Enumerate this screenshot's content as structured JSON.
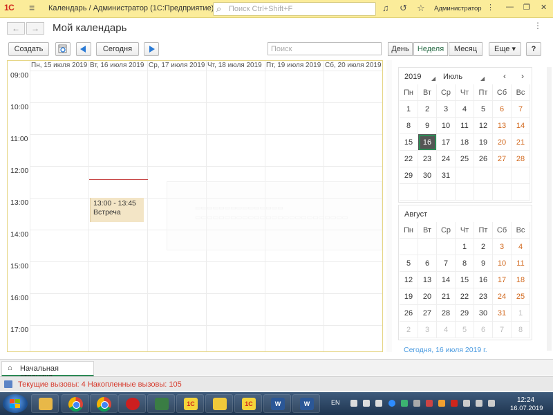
{
  "window": {
    "logo": "1С",
    "title": "Календарь / Администратор  (1С:Предприятие)",
    "search_placeholder": "Поиск Ctrl+Shift+F",
    "user": "Администратор"
  },
  "header": {
    "page_title": "Мой календарь",
    "back": "←",
    "forward": "→"
  },
  "toolbar": {
    "create_label": "Создать",
    "today_label": "Сегодня",
    "search_placeholder": "Поиск",
    "views": [
      "День",
      "Неделя",
      "Месяц"
    ],
    "active_view": "Неделя",
    "more_label": "Еще ▾",
    "help_label": "?"
  },
  "calendar": {
    "days": [
      "Пн, 15 июля 2019",
      "Вт, 16 июля 2019",
      "Ср, 17 июля 2019",
      "Чт, 18 июля 2019",
      "Пт, 19 июля 2019",
      "Сб, 20 июля 2019"
    ],
    "hours": [
      "09:00",
      "10:00",
      "11:00",
      "12:00",
      "13:00",
      "14:00",
      "15:00",
      "16:00",
      "17:00"
    ],
    "event": {
      "time": "13:00 - 13:45",
      "title": "Встреча"
    }
  },
  "mini_cal_1": {
    "year": "2019",
    "month": "Июль",
    "prev": "‹",
    "next": "›",
    "weekdays": [
      "Пн",
      "Вт",
      "Ср",
      "Чт",
      "Пт",
      "Сб",
      "Вс"
    ],
    "weeks": [
      [
        "1",
        "2",
        "3",
        "4",
        "5",
        "6",
        "7"
      ],
      [
        "8",
        "9",
        "10",
        "11",
        "12",
        "13",
        "14"
      ],
      [
        "15",
        "16",
        "17",
        "18",
        "19",
        "20",
        "21"
      ],
      [
        "22",
        "23",
        "24",
        "25",
        "26",
        "27",
        "28"
      ],
      [
        "29",
        "30",
        "31",
        "",
        "",
        "",
        ""
      ],
      [
        "",
        "",
        "",
        "",
        "",
        "",
        ""
      ]
    ],
    "selected": "16"
  },
  "mini_cal_2": {
    "month": "Август",
    "weekdays": [
      "Пн",
      "Вт",
      "Ср",
      "Чт",
      "Пт",
      "Сб",
      "Вс"
    ],
    "weeks": [
      [
        "",
        "",
        "",
        "1",
        "2",
        "3",
        "4"
      ],
      [
        "5",
        "6",
        "7",
        "8",
        "9",
        "10",
        "11"
      ],
      [
        "12",
        "13",
        "14",
        "15",
        "16",
        "17",
        "18"
      ],
      [
        "19",
        "20",
        "21",
        "22",
        "23",
        "24",
        "25"
      ],
      [
        "26",
        "27",
        "28",
        "29",
        "30",
        "31",
        "1"
      ],
      [
        "2",
        "3",
        "4",
        "5",
        "6",
        "7",
        "8"
      ]
    ],
    "next_month_start_row": 4,
    "next_month_start_col": 6
  },
  "today_link": "Сегодня, 16 июля 2019 г.",
  "tabs": {
    "home": "Начальная страница"
  },
  "status": {
    "text": "Текущие вызовы: 4   Накопленные вызовы: 105"
  },
  "taskbar": {
    "lang": "EN",
    "time": "12:24",
    "date": "16.07.2019",
    "apps": [
      "folder",
      "chrome",
      "chrome",
      "opera",
      "monitor",
      "1c",
      "pencil",
      "1c",
      "word",
      "word"
    ]
  },
  "colors": {
    "titlebar": "#fbec9a",
    "accent_green": "#2e8b57",
    "weekend": "#d2691e",
    "event_bg": "#f3e5c6",
    "now_line": "#c84848",
    "status_text": "#d6392b"
  }
}
